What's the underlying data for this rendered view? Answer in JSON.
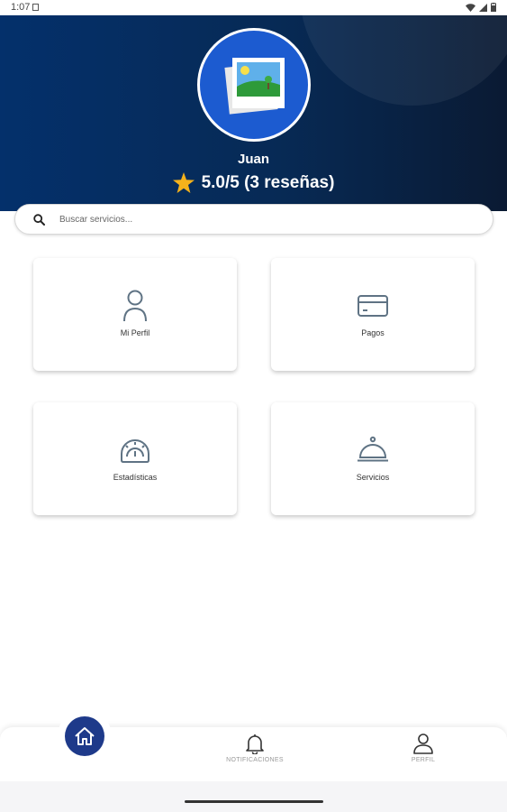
{
  "status_bar": {
    "time": "1:07"
  },
  "header": {
    "user_name": "Juan",
    "rating_text": "5.0/5 (3 reseñas)"
  },
  "search": {
    "placeholder": "Buscar servicios..."
  },
  "cards": [
    {
      "label": "Mi Perfil",
      "icon": "person-icon"
    },
    {
      "label": "Pagos",
      "icon": "credit-card-icon"
    },
    {
      "label": "Estadísticas",
      "icon": "gauge-icon"
    },
    {
      "label": "Servicios",
      "icon": "cloche-icon"
    }
  ],
  "bottom_nav": {
    "home_icon": "home-icon",
    "notifications_label": "NOTIFICACIONES",
    "profile_label": "PERFIL"
  },
  "colors": {
    "header_start": "#04306b",
    "header_end": "#0a1a33",
    "avatar_bg": "#1c5bd0",
    "star": "#f5b21b",
    "home_button": "#1e3a8a",
    "card_icon": "#5f7384"
  }
}
